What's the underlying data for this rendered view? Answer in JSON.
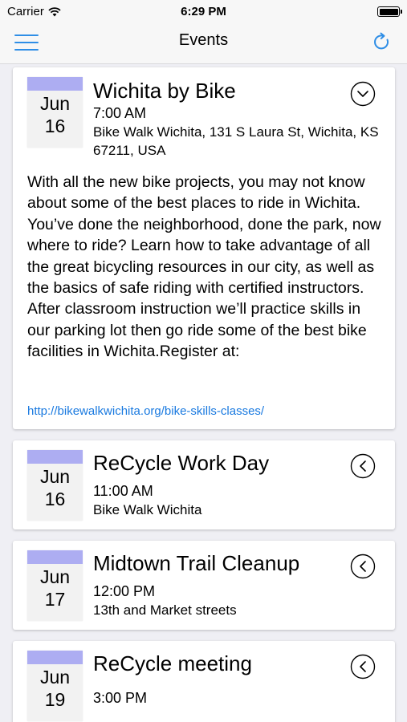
{
  "status_bar": {
    "carrier": "Carrier",
    "time": "6:29 PM"
  },
  "nav": {
    "title": "Events"
  },
  "events": [
    {
      "title": "Wichita by Bike",
      "month": "Jun",
      "day": "16",
      "time": "7:00 AM",
      "location": "Bike Walk Wichita, 131 S Laura St, Wichita, KS 67211, USA",
      "expanded": true,
      "description": "With all the new bike projects, you may not know about some of the best places to ride in Wichita. You’ve done the neighborhood, done the park, now where to ride? Learn how to take advantage of all the great bicycling resources in our city, as well as the basics of safe riding with certified instructors. After classroom instruction we’ll practice skills in our parking lot then go ride some of the best bike facilities in Wichita.Register at:",
      "link": "http://bikewalkwichita.org/bike-skills-classes/"
    },
    {
      "title": "ReCycle Work Day",
      "month": "Jun",
      "day": "16",
      "time": "11:00 AM",
      "location": "Bike Walk Wichita",
      "expanded": false
    },
    {
      "title": "Midtown Trail Cleanup",
      "month": "Jun",
      "day": "17",
      "time": "12:00 PM",
      "location": "13th and Market streets",
      "expanded": false
    },
    {
      "title": "ReCycle meeting",
      "month": "Jun",
      "day": "19",
      "time": "3:00 PM",
      "expanded": false
    }
  ],
  "colors": {
    "accent": "#2f8ee6",
    "date_header": "#adadf2",
    "link": "#1a7ae0"
  }
}
